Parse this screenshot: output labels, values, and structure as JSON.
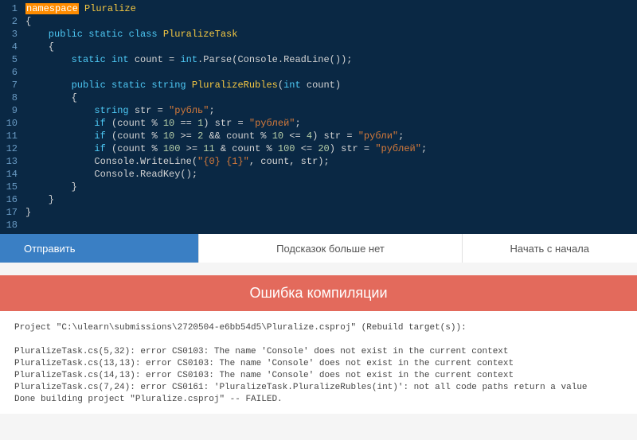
{
  "editor": {
    "line_count": 18,
    "code": {
      "l1_ns": "namespace",
      "l1_name": " Pluralize",
      "l2": "{",
      "l3_kw": "    public static class",
      "l3_cls": " PluralizeTask",
      "l4": "    {",
      "l5_kw1": "        static int",
      "l5_id1": " count = ",
      "l5_kw2": "int",
      "l5_id2": ".Parse(Console.ReadLine());",
      "l6": "",
      "l7_kw": "        public static string",
      "l7_cls": " PluralizeRubles",
      "l7_args1": "(",
      "l7_kw2": "int",
      "l7_args2": " count)",
      "l8": "        {",
      "l9_kw": "            string",
      "l9_id": " str = ",
      "l9_str": "\"рубль\"",
      "l9_end": ";",
      "l10_kw": "            if",
      "l10_a": " (count % ",
      "l10_n1": "10",
      "l10_b": " == ",
      "l10_n2": "1",
      "l10_c": ") str = ",
      "l10_str": "\"рублей\"",
      "l10_end": ";",
      "l11_kw": "            if",
      "l11_a": " (count % ",
      "l11_n1": "10",
      "l11_b": " >= ",
      "l11_n2": "2",
      "l11_c": " && count % ",
      "l11_n3": "10",
      "l11_d": " <= ",
      "l11_n4": "4",
      "l11_e": ") str = ",
      "l11_str": "\"рубли\"",
      "l11_end": ";",
      "l12_kw": "            if",
      "l12_a": " (count % ",
      "l12_n1": "100",
      "l12_b": " >= ",
      "l12_n2": "11",
      "l12_c": " & count % ",
      "l12_n3": "100",
      "l12_d": " <= ",
      "l12_n4": "20",
      "l12_e": ") str = ",
      "l12_str": "\"рублей\"",
      "l12_end": ";",
      "l13_a": "            Console.WriteLine(",
      "l13_str": "\"{0} {1}\"",
      "l13_b": ", count, str);",
      "l14": "            Console.ReadKey();",
      "l15": "        }",
      "l16": "    }",
      "l17": "}",
      "l18": ""
    }
  },
  "buttons": {
    "submit": "Отправить",
    "hints": "Подсказок больше нет",
    "restart": "Начать с начала"
  },
  "error": {
    "title": "Ошибка компиляции",
    "output": "Project \"C:\\ulearn\\submissions\\2720504-e6bb54d5\\Pluralize.csproj\" (Rebuild target(s)):\n\nPluralizeTask.cs(5,32): error CS0103: The name 'Console' does not exist in the current context\nPluralizeTask.cs(13,13): error CS0103: The name 'Console' does not exist in the current context\nPluralizeTask.cs(14,13): error CS0103: The name 'Console' does not exist in the current context\nPluralizeTask.cs(7,24): error CS0161: 'PluralizeTask.PluralizeRubles(int)': not all code paths return a value\nDone building project \"Pluralize.csproj\" -- FAILED."
  }
}
